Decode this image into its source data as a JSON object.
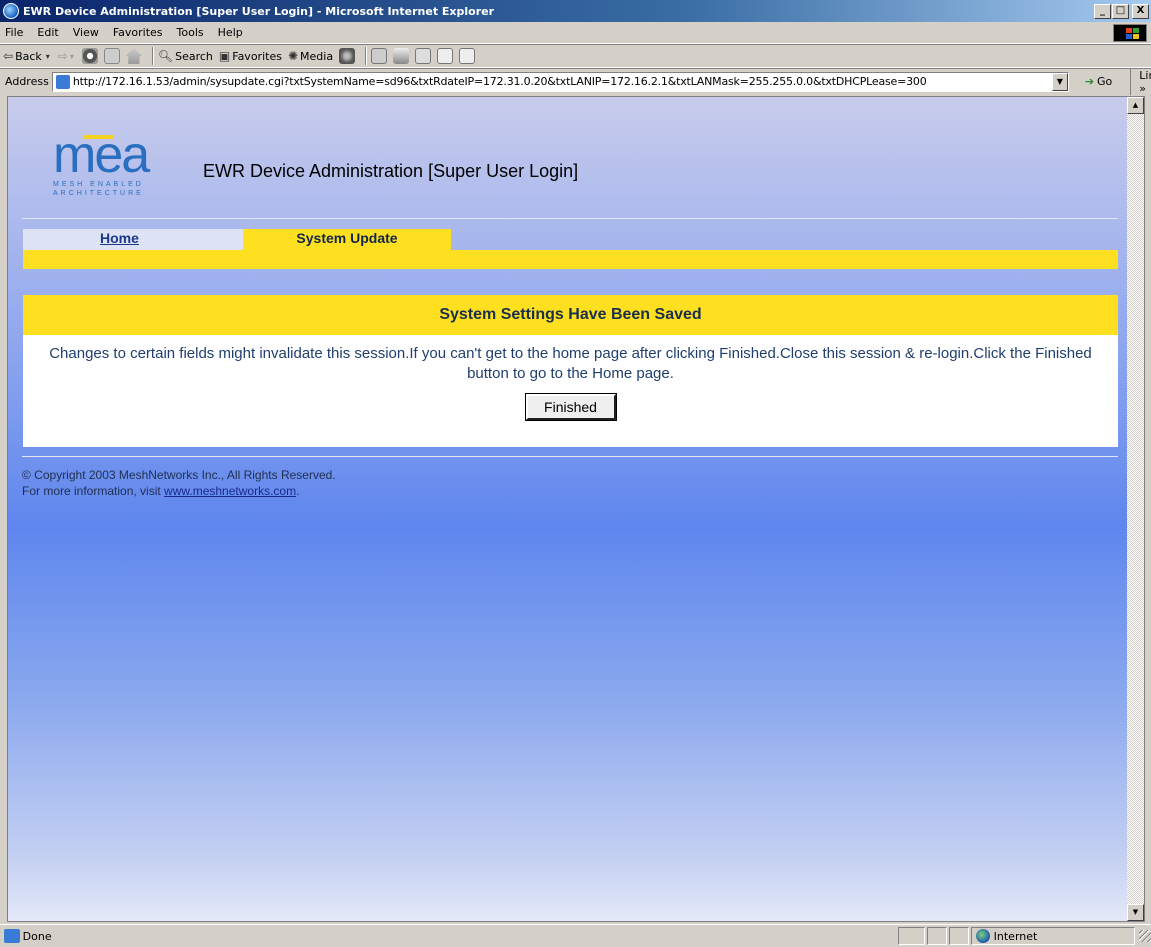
{
  "window": {
    "title": "EWR Device Administration [Super User Login] - Microsoft Internet Explorer",
    "minimize": "_",
    "maximize": "□",
    "close": "X"
  },
  "menu": [
    "File",
    "Edit",
    "View",
    "Favorites",
    "Tools",
    "Help"
  ],
  "toolbar": {
    "back": "Back",
    "search": "Search",
    "favorites": "Favorites",
    "media": "Media"
  },
  "address": {
    "label": "Address",
    "url": "http://172.16.1.53/admin/sysupdate.cgi?txtSystemName=sd96&txtRdateIP=172.31.0.20&txtLANIP=172.16.2.1&txtLANMask=255.255.0.0&txtDHCPLease=300",
    "go": "Go",
    "links": "Links"
  },
  "page": {
    "logo_word": "mea",
    "logo_line1": "MESH ENABLED",
    "logo_line2": "ARCHITECTURE",
    "heading": "EWR Device Administration [Super User Login]",
    "tabs": [
      {
        "label": "Home"
      },
      {
        "label": "System Update"
      }
    ],
    "notice_title": "System Settings Have Been Saved",
    "notice_message": "Changes to certain fields might invalidate this session.If you can't get to the home page after clicking Finished.Close this session & re-login.Click the Finished button to go to the Home page.",
    "finished_button": "Finished",
    "copyright": "© Copyright 2003 MeshNetworks Inc., All Rights Reserved.",
    "more_info_prefix": "For more information, visit",
    "more_info_link": "www.meshnetworks.com",
    "more_info_suffix": "."
  },
  "status": {
    "text": "Done",
    "zone": "Internet"
  },
  "colors": {
    "accent_yellow": "#fee020",
    "title_blue": "#0a246a",
    "link_blue": "#1a3a88"
  }
}
